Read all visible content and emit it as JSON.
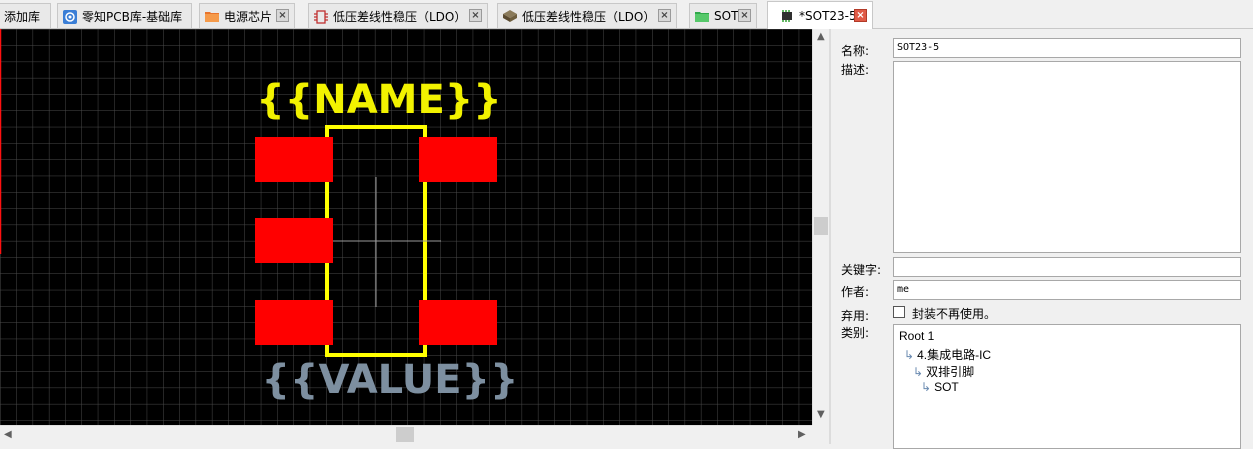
{
  "tabs": [
    {
      "label": "添加库",
      "icon": "none",
      "closable": false
    },
    {
      "label": "零知PCB库-基础库",
      "icon": "library-icon",
      "closable": false
    },
    {
      "label": "电源芯片",
      "icon": "folder-icon",
      "closable": true
    },
    {
      "label": "低压差线性稳压（LDO）",
      "icon": "schematic-icon",
      "closable": true
    },
    {
      "label": "低压差线性稳压（LDO）",
      "icon": "chip-3d-icon",
      "closable": true
    },
    {
      "label": "SOT",
      "icon": "folder-green-icon",
      "closable": true
    },
    {
      "label": "*SOT23-5",
      "icon": "footprint-icon",
      "closable": true,
      "active": true
    }
  ],
  "canvas": {
    "name_text": "{{NAME}}",
    "value_text": "{{VALUE}}",
    "colors": {
      "background": "#000000",
      "grid": "#4a4a4a",
      "outline": "#ffff00",
      "pad": "#ff0000",
      "name": "#f2f200",
      "value": "#7d8fa0",
      "crosshair": "#9a9a9a"
    }
  },
  "panel": {
    "name_label": "名称:",
    "name_value": "SOT23-5",
    "desc_label": "描述:",
    "desc_value": "",
    "keywords_label": "关键字:",
    "keywords_value": "",
    "author_label": "作者:",
    "author_value": "me",
    "deprecated_label": "弃用:",
    "deprecated_checkbox_label": "封装不再使用。",
    "deprecated_checked": false,
    "category_label": "类别:",
    "category_tree": [
      {
        "label": "Root 1",
        "level": 0
      },
      {
        "label": "4.集成电路-IC",
        "level": 1
      },
      {
        "label": "双排引脚",
        "level": 2
      },
      {
        "label": "SOT",
        "level": 3
      }
    ]
  }
}
